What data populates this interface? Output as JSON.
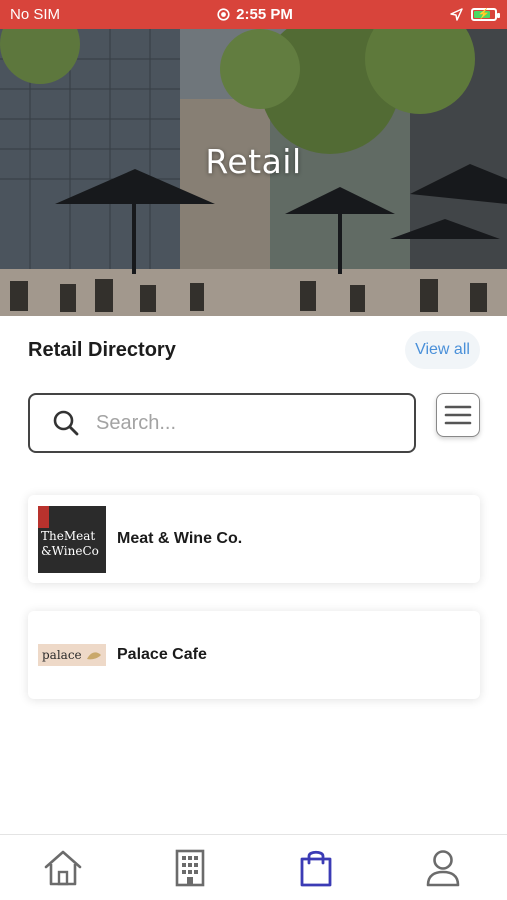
{
  "status_bar": {
    "carrier": "No SIM",
    "time": "2:55 PM"
  },
  "hero": {
    "title": "Retail"
  },
  "directory": {
    "title": "Retail Directory",
    "view_all_label": "View all"
  },
  "search": {
    "placeholder": "Search..."
  },
  "retailers": [
    {
      "name": "Meat & Wine Co.",
      "logo_text_line1": "TheMeat",
      "logo_text_line2": "&WineCo"
    },
    {
      "name": "Palace Cafe",
      "logo_text": "palace"
    }
  ],
  "bottom_nav": {
    "items": [
      {
        "icon": "home-icon",
        "active": false
      },
      {
        "icon": "building-icon",
        "active": false
      },
      {
        "icon": "shopping-bag-icon",
        "active": true
      },
      {
        "icon": "profile-icon",
        "active": false
      }
    ]
  },
  "colors": {
    "status_bar_bg": "#d8443b",
    "accent": "#3b3bb5",
    "link": "#4a90d9",
    "nav_inactive": "#6b6b6b"
  }
}
